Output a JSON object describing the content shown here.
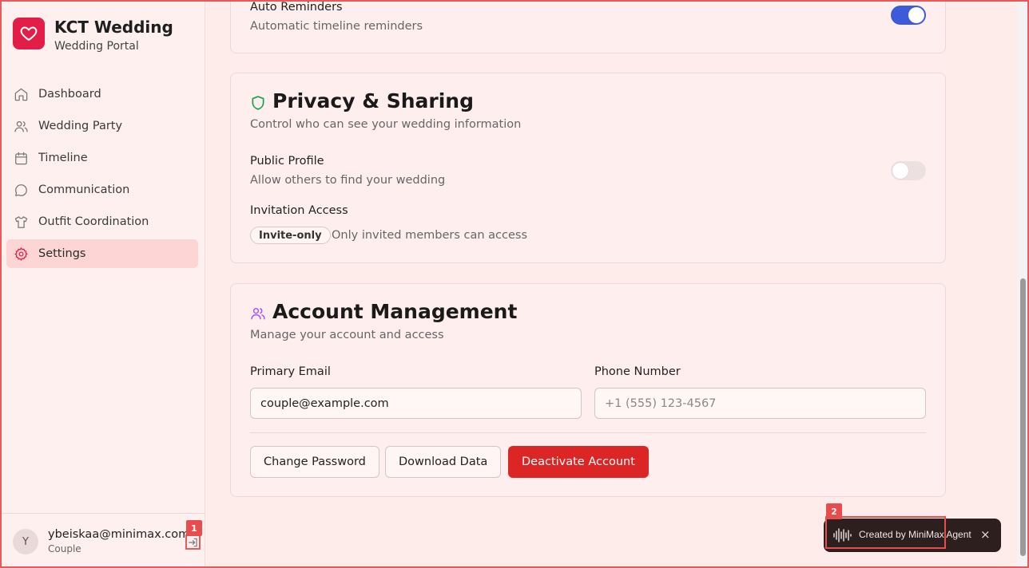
{
  "brand": {
    "title": "KCT Wedding",
    "subtitle": "Wedding Portal"
  },
  "nav": [
    {
      "label": "Dashboard",
      "icon": "home-icon"
    },
    {
      "label": "Wedding Party",
      "icon": "users-icon"
    },
    {
      "label": "Timeline",
      "icon": "calendar-icon"
    },
    {
      "label": "Communication",
      "icon": "chat-icon"
    },
    {
      "label": "Outfit Coordination",
      "icon": "shirt-icon"
    },
    {
      "label": "Settings",
      "icon": "gear-icon",
      "active": true
    }
  ],
  "user": {
    "avatar_letter": "Y",
    "email": "ybeiskaa@minimax.com",
    "role": "Couple"
  },
  "markers": {
    "logout": "1",
    "toast": "2"
  },
  "notifications": {
    "auto_reminders_label": "Auto Reminders",
    "auto_reminders_sub": "Automatic timeline reminders",
    "auto_reminders_on": true
  },
  "privacy": {
    "title": "Privacy & Sharing",
    "desc": "Control who can see your wedding information",
    "public_profile_label": "Public Profile",
    "public_profile_sub": "Allow others to find your wedding",
    "public_profile_on": false,
    "invitation_label": "Invitation Access",
    "invitation_badge": "Invite-only",
    "invitation_sub": "Only invited members can access"
  },
  "account": {
    "title": "Account Management",
    "desc": "Manage your account and access",
    "email_label": "Primary Email",
    "email_value": "couple@example.com",
    "phone_label": "Phone Number",
    "phone_placeholder": "+1 (555) 123-4567",
    "change_password": "Change Password",
    "download_data": "Download Data",
    "deactivate": "Deactivate Account"
  },
  "toast": {
    "text": "Created by MiniMax Agent",
    "close": "×"
  },
  "colors": {
    "accent": "#e11d48",
    "toggle_on": "#3b5bdb",
    "danger": "#dc2626",
    "privacy_icon": "#16a34a",
    "account_icon": "#a855f7"
  }
}
